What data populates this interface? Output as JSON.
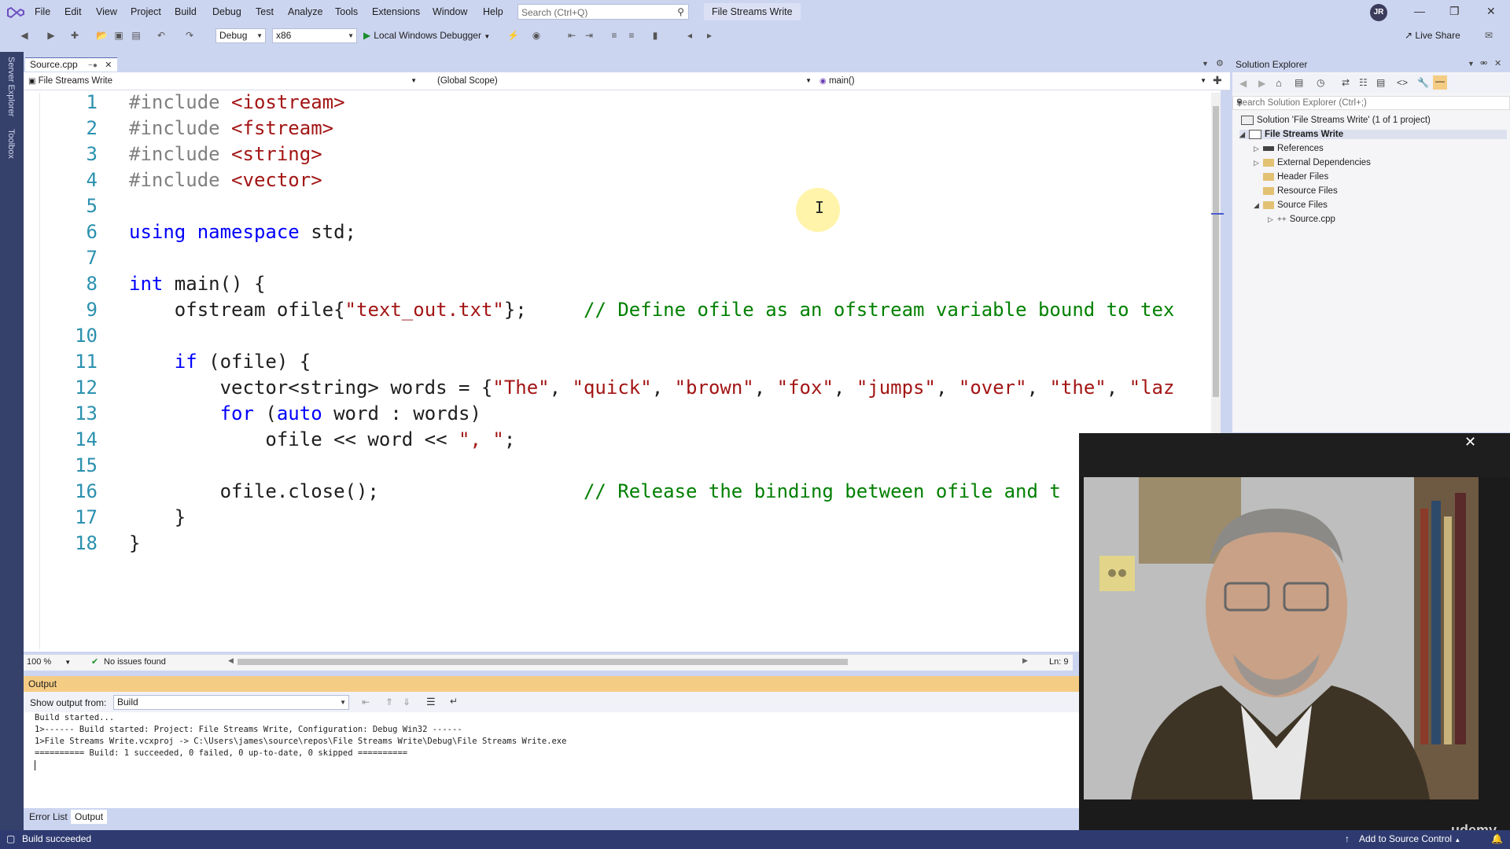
{
  "menubar": {
    "items": [
      "File",
      "Edit",
      "View",
      "Project",
      "Build",
      "Debug",
      "Test",
      "Analyze",
      "Tools",
      "Extensions",
      "Window",
      "Help"
    ],
    "search_placeholder": "Search (Ctrl+Q)",
    "solution_name": "File Streams Write",
    "avatar_initials": "JR"
  },
  "toolbar": {
    "config": "Debug",
    "platform": "x86",
    "run_label": "Local Windows Debugger",
    "live_share": "Live Share"
  },
  "side_tabs": [
    "Server Explorer",
    "Toolbox"
  ],
  "editor": {
    "tab_name": "Source.cpp",
    "nav_project": "File Streams Write",
    "nav_scope": "(Global Scope)",
    "nav_function": "main()",
    "zoom": "100 %",
    "issues": "No issues found",
    "line_col": "Ln: 9",
    "line_numbers": [
      "1",
      "2",
      "3",
      "4",
      "5",
      "6",
      "7",
      "8",
      "9",
      "10",
      "11",
      "12",
      "13",
      "14",
      "15",
      "16",
      "17",
      "18"
    ]
  },
  "output": {
    "title": "Output",
    "show_from_label": "Show output from:",
    "show_from_value": "Build",
    "lines": [
      "Build started...",
      "1>------ Build started: Project: File Streams Write, Configuration: Debug Win32 ------",
      "1>File Streams Write.vcxproj -> C:\\Users\\james\\source\\repos\\File Streams Write\\Debug\\File Streams Write.exe",
      "========== Build: 1 succeeded, 0 failed, 0 up-to-date, 0 skipped =========="
    ]
  },
  "bottom_tabs": [
    "Error List",
    "Output"
  ],
  "solution_explorer": {
    "title": "Solution Explorer",
    "search_placeholder": "Search Solution Explorer (Ctrl+;)",
    "solution": "Solution 'File Streams Write' (1 of 1 project)",
    "project": "File Streams Write",
    "nodes": [
      "References",
      "External Dependencies",
      "Header Files",
      "Resource Files",
      "Source Files"
    ],
    "source_file": "Source.cpp"
  },
  "webcam": {
    "watermark": "udemy"
  },
  "statusbar": {
    "message": "Build succeeded",
    "source_control": "Add to Source Control"
  },
  "colors": {
    "chrome": "#ccd5f0",
    "keyword": "#0000ff",
    "string": "#a31515",
    "comment": "#008000",
    "line_number": "#2b91af",
    "output_header": "#f5cc84",
    "statusbar": "#2f3b70"
  }
}
